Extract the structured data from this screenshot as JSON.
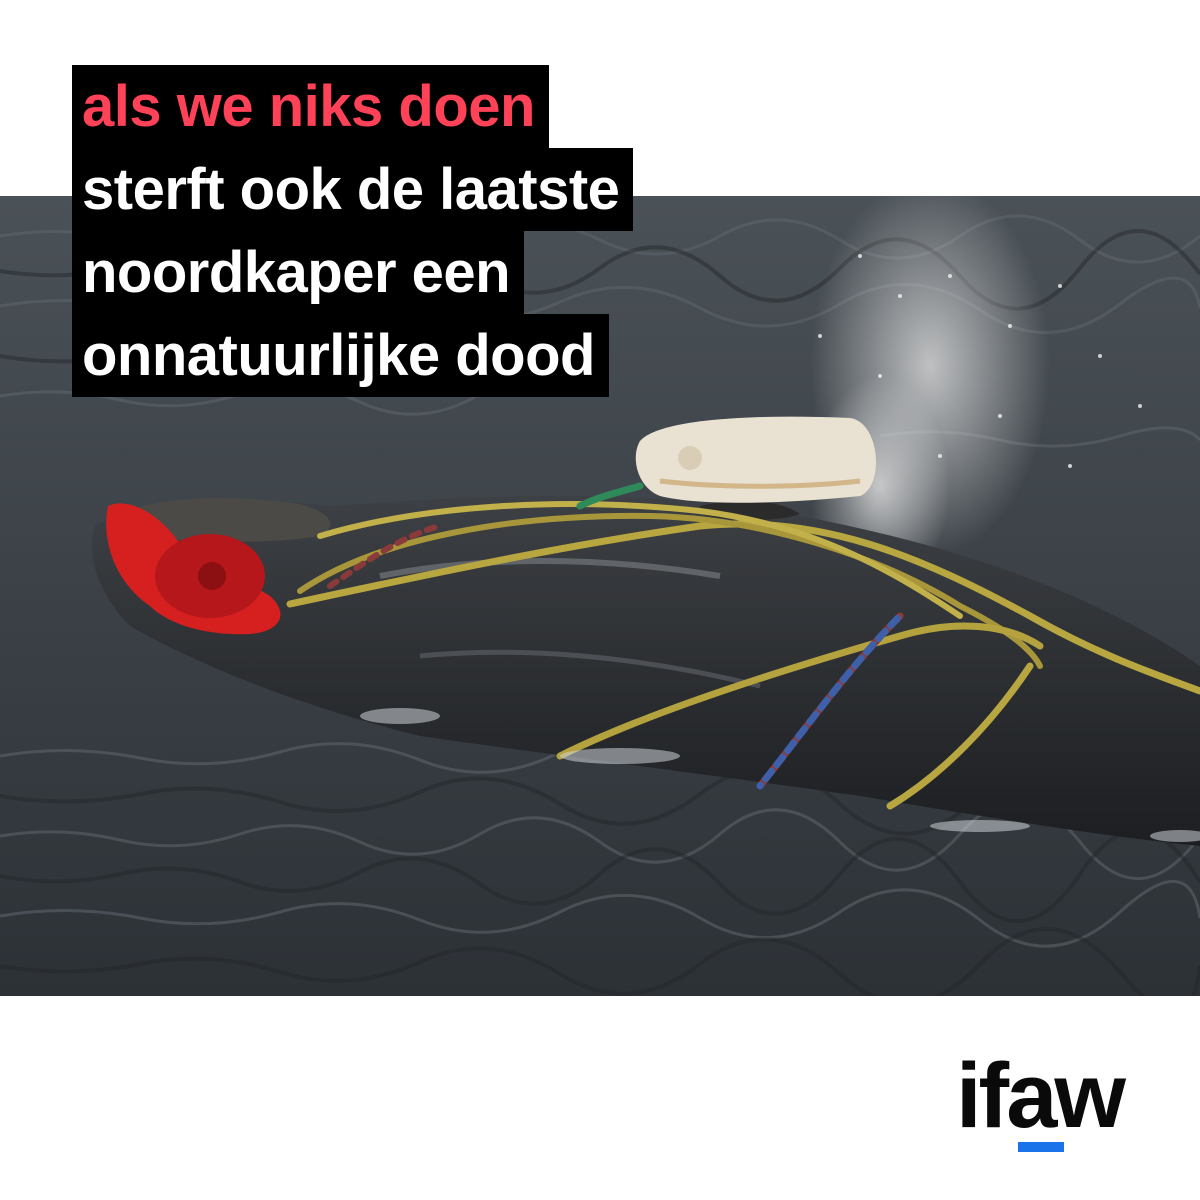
{
  "headline": {
    "line1": "als we niks doen",
    "line2": "sterft ook de laatste",
    "line3": "noordkaper een",
    "line4": "onnatuurlijke dood"
  },
  "logo": {
    "text": "ifaw"
  },
  "colors": {
    "highlight": "#ff4257",
    "text_box": "#000000",
    "logo_accent": "#1a73e8"
  }
}
